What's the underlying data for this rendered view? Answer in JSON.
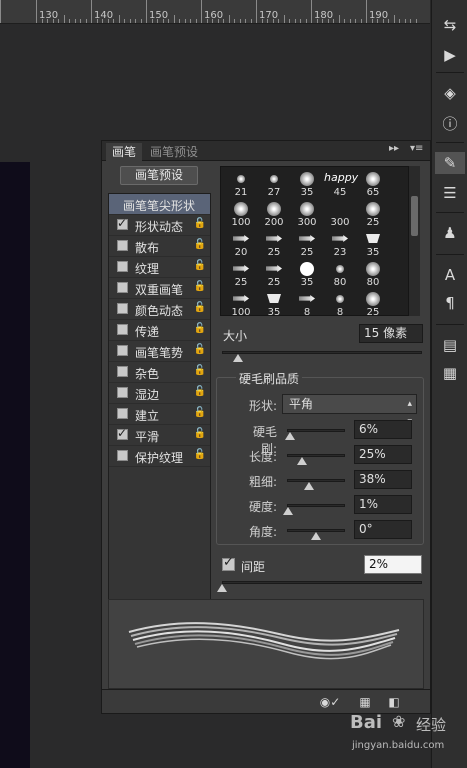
{
  "ruler": {
    "labels": [
      "130",
      "140",
      "150",
      "160",
      "170",
      "180",
      "190"
    ]
  },
  "panel": {
    "tabs": [
      "画笔",
      "画笔预设"
    ],
    "tab_controls": {
      "collapse": "▸▸",
      "menu": "▾≡"
    },
    "preset_button": "画笔预设",
    "list": [
      {
        "label": "画笔笔尖形状",
        "checked": null,
        "lock": false
      },
      {
        "label": "形状动态",
        "checked": true,
        "lock": true
      },
      {
        "label": "散布",
        "checked": false,
        "lock": true
      },
      {
        "label": "纹理",
        "checked": false,
        "lock": true
      },
      {
        "label": "双重画笔",
        "checked": false,
        "lock": true
      },
      {
        "label": "颜色动态",
        "checked": false,
        "lock": true
      },
      {
        "label": "传递",
        "checked": false,
        "lock": true
      },
      {
        "label": "画笔笔势",
        "checked": false,
        "lock": true
      },
      {
        "label": "杂色",
        "checked": false,
        "lock": true
      },
      {
        "label": "湿边",
        "checked": false,
        "lock": true
      },
      {
        "label": "建立",
        "checked": false,
        "lock": true
      },
      {
        "label": "平滑",
        "checked": true,
        "lock": true
      },
      {
        "label": "保护纹理",
        "checked": false,
        "lock": true
      }
    ],
    "tips": [
      [
        "21",
        "27",
        "35",
        "45",
        "65"
      ],
      [
        "100",
        "200",
        "300",
        "300",
        "25"
      ],
      [
        "20",
        "25",
        "25",
        "23",
        "35"
      ],
      [
        "25",
        "25",
        "35",
        "80",
        "80"
      ],
      [
        "100",
        "35",
        "8",
        "8",
        "25"
      ]
    ],
    "tip_shapes": [
      [
        "dot-small",
        "dot-small",
        "dot",
        "text",
        "dot"
      ],
      [
        "dot",
        "dot",
        "dot",
        "text",
        "dot"
      ],
      [
        "arrow",
        "arrow",
        "arrow",
        "arrow",
        "fan"
      ],
      [
        "arrow",
        "arrow",
        "hard",
        "dot-small",
        "dot"
      ],
      [
        "arrow",
        "fan",
        "arrow",
        "dot-small",
        "dot"
      ]
    ],
    "tip_text": {
      "happy": "happy"
    },
    "size": {
      "label": "大小",
      "value": "15 像素",
      "level": 0.08
    },
    "bristle": {
      "title": "硬毛刷品质",
      "shape_label": "形状:",
      "shape_value": "平角",
      "props": [
        {
          "label": "硬毛刷:",
          "value": "6%",
          "level": 0.06
        },
        {
          "label": "长度:",
          "value": "25%",
          "level": 0.25
        },
        {
          "label": "粗细:",
          "value": "38%",
          "level": 0.38
        },
        {
          "label": "硬度:",
          "value": "1%",
          "level": 0.01
        },
        {
          "label": "角度:",
          "value": "0°",
          "level": 0.5
        }
      ]
    },
    "spacing": {
      "label": "间距",
      "checked": true,
      "value": "2%",
      "level": 0.0
    },
    "bottom_icons": [
      "brush-toggle-icon",
      "grid-icon",
      "new-preset-icon"
    ]
  },
  "toolbar_icons": [
    "history-icon",
    "play-icon",
    "3d-icon",
    "info-icon",
    "brush-icon",
    "adjust-icon",
    "stamp-icon",
    "character-icon",
    "paragraph-icon",
    "layers-icon",
    "notes-icon"
  ],
  "watermark": {
    "logo": "Bai",
    "cn": "经验",
    "url": "jingyan.baidu.com"
  },
  "colors": {
    "panel_bg": "#3d3d3d",
    "highlight": "#5a6478",
    "canvas": "#0f0c1a"
  }
}
